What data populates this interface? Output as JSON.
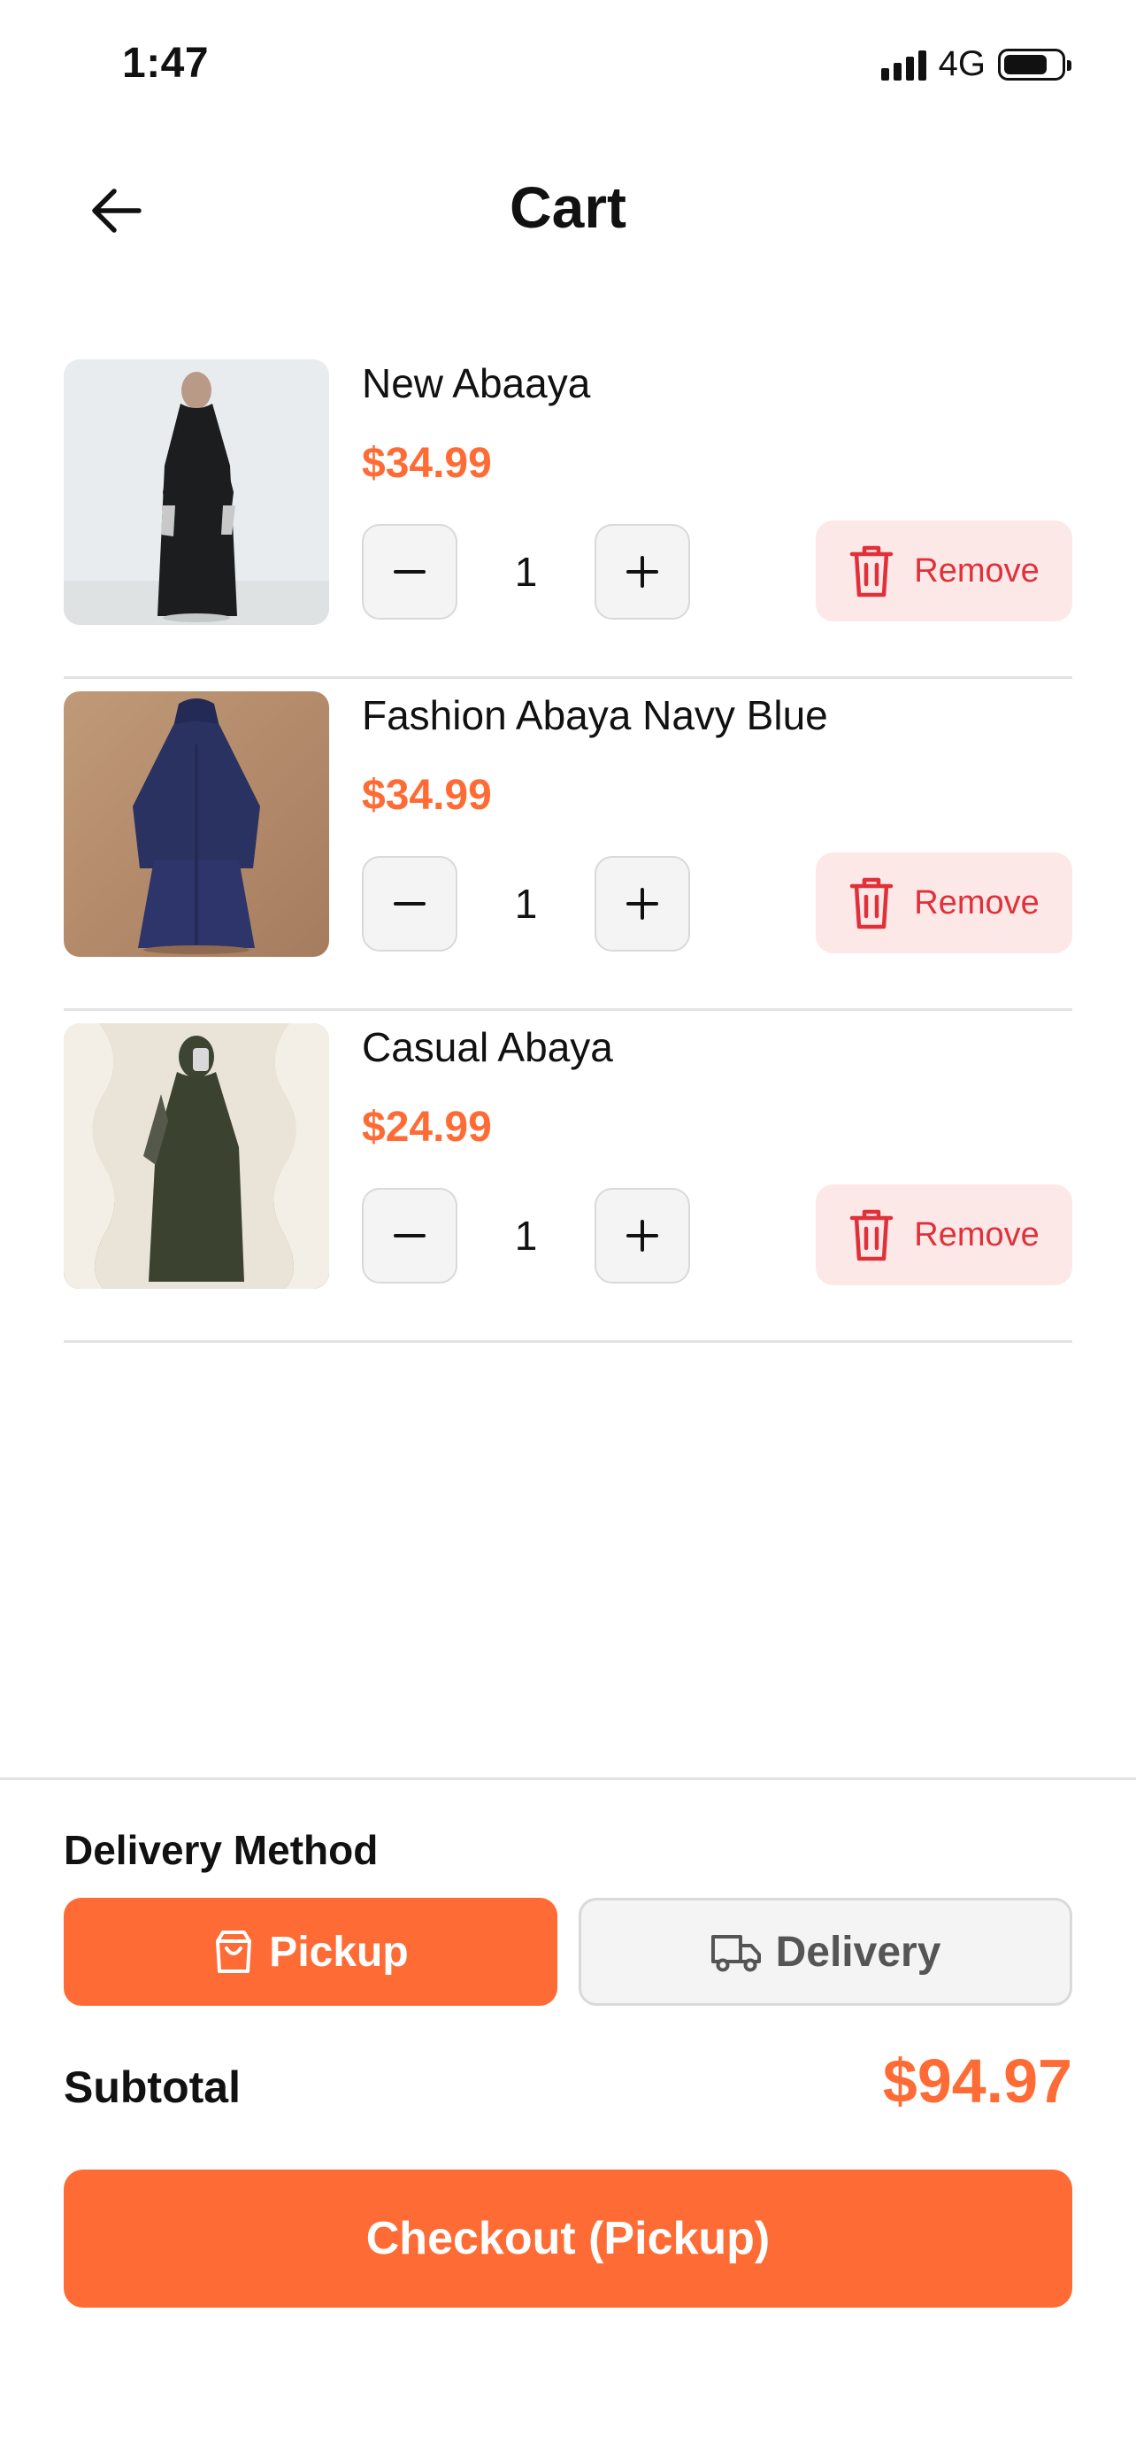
{
  "status_bar": {
    "time": "1:47",
    "network": "4G",
    "battery_level": 0.75,
    "signal_bars": 4
  },
  "header": {
    "title": "Cart",
    "back_icon": "arrow-left-icon"
  },
  "items": [
    {
      "name": "New Abaaya",
      "price": "$34.99",
      "quantity": "1",
      "remove_label": "Remove"
    },
    {
      "name": "Fashion Abaya Navy Blue",
      "price": "$34.99",
      "quantity": "1",
      "remove_label": "Remove"
    },
    {
      "name": "Casual Abaya",
      "price": "$24.99",
      "quantity": "1",
      "remove_label": "Remove"
    }
  ],
  "delivery": {
    "title": "Delivery Method",
    "options": [
      {
        "label": "Pickup",
        "icon": "shopping-bag-icon",
        "selected": true
      },
      {
        "label": "Delivery",
        "icon": "truck-icon",
        "selected": false
      }
    ]
  },
  "summary": {
    "subtotal_label": "Subtotal",
    "subtotal_value": "$94.97"
  },
  "checkout": {
    "label": "Checkout (Pickup)"
  },
  "colors": {
    "accent": "#ff6b35",
    "danger": "#e0313b",
    "danger_bg": "#fde8e8",
    "neutral_bg": "#f4f4f4"
  }
}
